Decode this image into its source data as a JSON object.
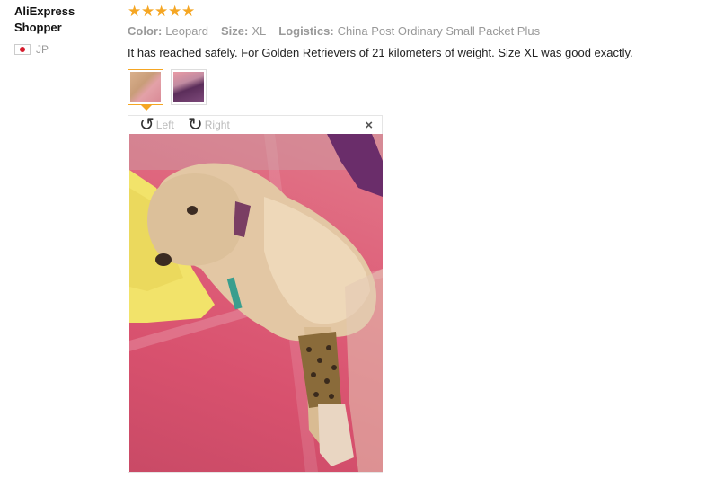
{
  "author": {
    "name": "AliExpress Shopper",
    "country": "JP"
  },
  "review": {
    "rating": 5,
    "stars": [
      "★",
      "★",
      "★",
      "★",
      "★"
    ],
    "attributes": [
      {
        "key": "Color:",
        "value": "Leopard"
      },
      {
        "key": "Size:",
        "value": "XL"
      },
      {
        "key": "Logistics:",
        "value": "China Post Ordinary Small Packet Plus"
      }
    ],
    "text": "It has reached safely. For Golden Retrievers of 21 kilometers of weight. Size XL was good exactly."
  },
  "viewer": {
    "rotate_left_label": "Left",
    "rotate_right_label": "Right",
    "close_symbol": "×",
    "rotate_left_icon": "↺",
    "rotate_right_icon": "↻"
  },
  "colors": {
    "star": "#f5a623",
    "thumb_active_border": "#f5a623",
    "flag_red": "#d61b2c"
  }
}
